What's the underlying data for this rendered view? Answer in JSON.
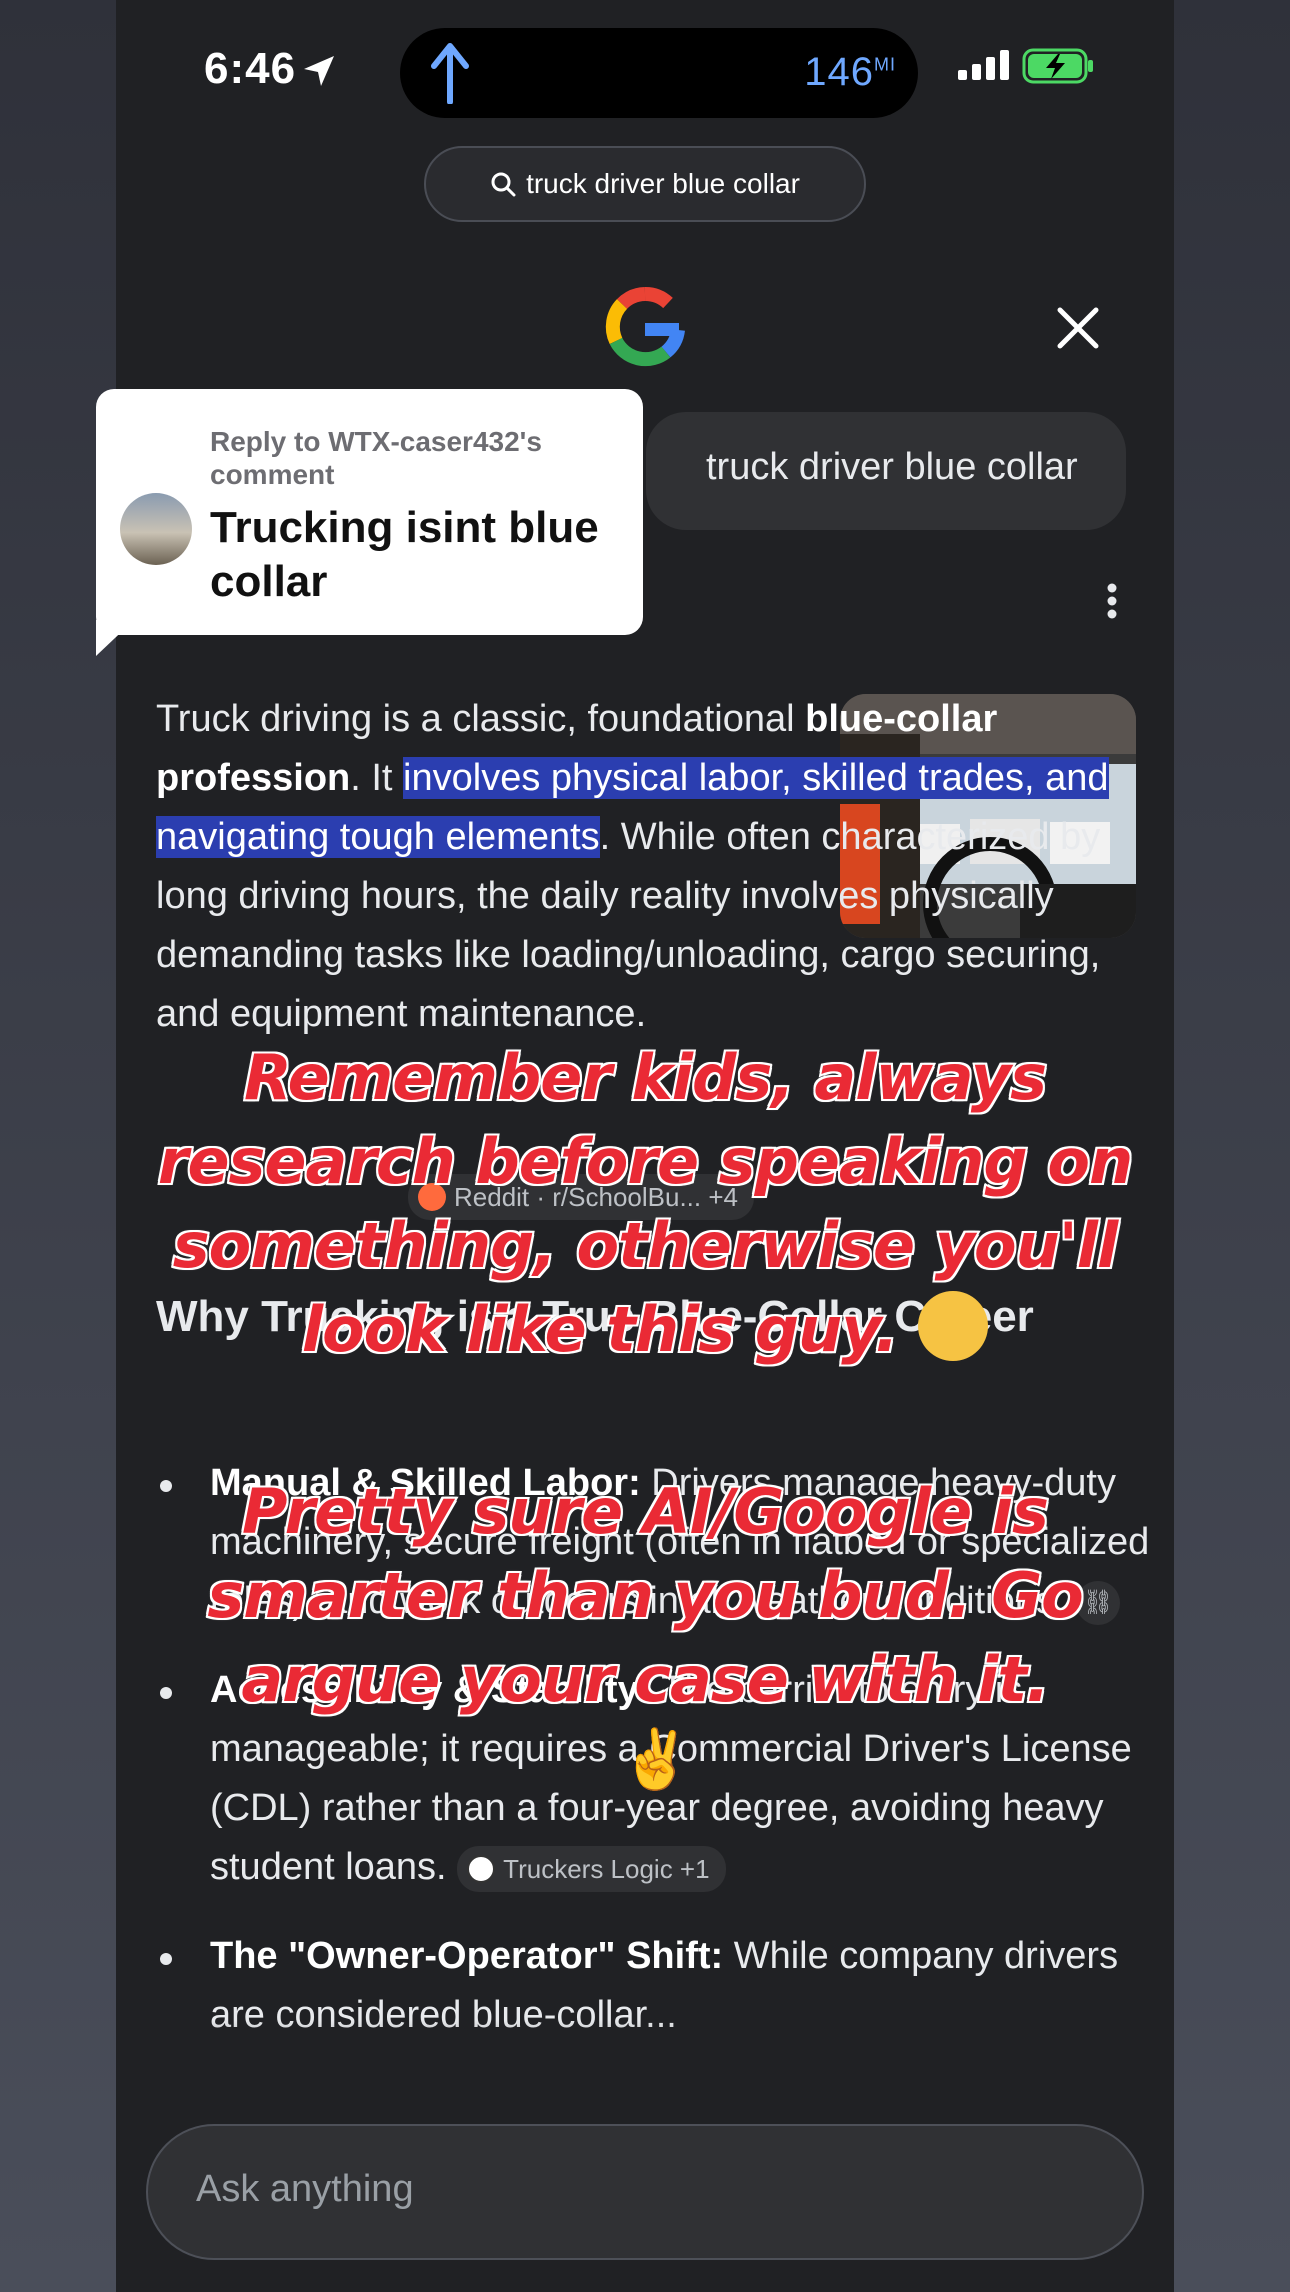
{
  "status_bar": {
    "time": "6:46",
    "distance": "146",
    "distance_unit": "MI"
  },
  "search_pill": {
    "query": "truck driver blue collar"
  },
  "query_bubble": {
    "text": "truck driver blue collar"
  },
  "reply_card": {
    "subtitle": "Reply to WTX-caser432's comment",
    "title": "Trucking isint blue collar"
  },
  "answer": {
    "p1_a": "Truck driving is a classic, foundational ",
    "p1_bold": "blue-collar profession",
    "p1_b": ". It ",
    "p1_highlight": "involves physical labor, skilled trades, and navigating tough elements",
    "p1_c": ". While often characterized by long driving hours, the daily reality involves physically demanding tasks like loading/unloading, cargo securing, and equipment maintenance. ",
    "source_chip": "Reddit · r/SchoolBu...  +4"
  },
  "heading": "Why Trucking is a True Blue-Collar Career",
  "bullets": [
    {
      "bold": "Manual & Skilled Labor:",
      "text": " Drivers manage heavy-duty machinery, secure freight (often in flatbed or specialized roles), and work outdoors in all weather conditions."
    },
    {
      "bold": "Accessibility & Stability:",
      "text": " The barrier to entry is manageable; it requires a Commercial Driver's License (CDL) rather than a four-year degree, avoiding heavy student loans.",
      "chip": "Truckers Logic +1"
    },
    {
      "bold": "The \"Owner-Operator\" Shift:",
      "text": " While company drivers are considered blue-collar..."
    }
  ],
  "input": {
    "placeholder": "Ask anything"
  },
  "captions": {
    "top": "Remember kids, always research before speaking on something, otherwise you'll look like this guy.",
    "bottom": "Pretty sure AI/Google is smarter than you bud. Go argue your case with it."
  },
  "colors": {
    "highlight": "#2b3eb0",
    "caption_red": "#ea2a35",
    "background": "#202124"
  },
  "icons": [
    "location-arrow-icon",
    "nav-up-arrow-icon",
    "signal-icon",
    "battery-charging-icon",
    "search-icon",
    "google-logo-icon",
    "close-icon",
    "more-vert-icon",
    "reddit-icon",
    "globe-icon",
    "link-icon"
  ]
}
